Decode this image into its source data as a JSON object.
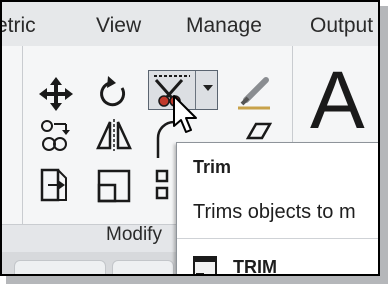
{
  "ribbon_tabs": [
    "etric",
    "View",
    "Manage",
    "Output"
  ],
  "modify_panel": {
    "title": "Modify",
    "tools": [
      {
        "name": "move",
        "icon": "move-icon"
      },
      {
        "name": "rotate",
        "icon": "rotate-icon"
      },
      {
        "name": "trim",
        "icon": "trim-icon"
      },
      {
        "name": "erase",
        "icon": "erase-icon"
      },
      {
        "name": "copy",
        "icon": "copy-icon"
      },
      {
        "name": "mirror",
        "icon": "mirror-icon"
      },
      {
        "name": "fillet",
        "icon": "fillet-icon"
      },
      {
        "name": "stretch",
        "icon": "stretch-icon"
      },
      {
        "name": "scale",
        "icon": "scale-icon"
      },
      {
        "name": "array",
        "icon": "array-icon"
      }
    ]
  },
  "annotation_panel": {
    "big_icon_text": "A"
  },
  "tooltip": {
    "title": "Trim",
    "description": "Trims objects to m",
    "command": "TRIM"
  },
  "colors": {
    "ribbon_bg": "#f5f6f7",
    "tab_bar_bg": "#e6e8ea",
    "highlight_button": "#dcdfe3"
  }
}
